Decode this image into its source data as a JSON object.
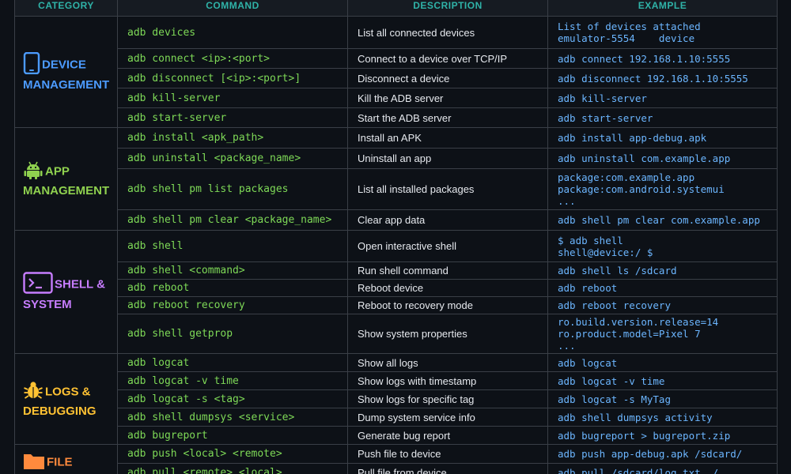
{
  "headers": {
    "category": "CATEGORY",
    "command": "COMMAND",
    "description": "DESCRIPTION",
    "example": "EXAMPLE"
  },
  "colors": {
    "device": "#4c9bff",
    "app": "#8fd14f",
    "shell": "#c77dff",
    "logs": "#ffc233",
    "file": "#ff8a3d",
    "command_text": "#7ed957",
    "example_text": "#6cb6ff",
    "header_text": "#2fb3a8"
  },
  "categories": [
    {
      "icon": "smartphone-icon",
      "line1": "DEVICE",
      "line2": "MANAGEMENT",
      "rows": [
        {
          "cmd": "adb devices",
          "desc": "List all connected devices",
          "ex": "List of devices attached\nemulator-5554    device"
        },
        {
          "cmd": "adb connect <ip>:<port>",
          "desc": "Connect to a device over TCP/IP",
          "ex": "adb connect 192.168.1.10:5555"
        },
        {
          "cmd": "adb disconnect [<ip>:<port>]",
          "desc": "Disconnect a device",
          "ex": "adb disconnect 192.168.1.10:5555"
        },
        {
          "cmd": "adb kill-server",
          "desc": "Kill the ADB server",
          "ex": "adb kill-server"
        },
        {
          "cmd": "adb start-server",
          "desc": "Start the ADB server",
          "ex": "adb start-server"
        }
      ]
    },
    {
      "icon": "android-icon",
      "line1": "APP",
      "line2": "MANAGEMENT",
      "rows": [
        {
          "cmd": "adb install <apk_path>",
          "desc": "Install an APK",
          "ex": "adb install app-debug.apk"
        },
        {
          "cmd": "adb uninstall <package_name>",
          "desc": "Uninstall an app",
          "ex": "adb uninstall com.example.app"
        },
        {
          "cmd": "adb shell pm list packages",
          "desc": "List all installed packages",
          "ex": "package:com.example.app\npackage:com.android.systemui\n..."
        },
        {
          "cmd": "adb shell pm clear <package_name>",
          "desc": "Clear app data",
          "ex": "adb shell pm clear com.example.app"
        }
      ]
    },
    {
      "icon": "terminal-icon",
      "line1": "SHELL &",
      "line2": "SYSTEM",
      "rows": [
        {
          "cmd": "adb shell",
          "desc": "Open interactive shell",
          "ex": "$ adb shell\nshell@device:/ $"
        },
        {
          "cmd": "adb shell <command>",
          "desc": "Run shell command",
          "ex": "adb shell ls /sdcard"
        },
        {
          "cmd": "adb reboot",
          "desc": "Reboot device",
          "ex": "adb reboot"
        },
        {
          "cmd": "adb reboot recovery",
          "desc": "Reboot to recovery mode",
          "ex": "adb reboot recovery"
        },
        {
          "cmd": "adb shell getprop",
          "desc": "Show system properties",
          "ex": "ro.build.version.release=14\nro.product.model=Pixel 7\n..."
        }
      ]
    },
    {
      "icon": "bug-icon",
      "line1": "LOGS &",
      "line2": "DEBUGGING",
      "rows": [
        {
          "cmd": "adb logcat",
          "desc": "Show all logs",
          "ex": "adb logcat"
        },
        {
          "cmd": "adb logcat -v time",
          "desc": "Show logs with timestamp",
          "ex": "adb logcat -v time"
        },
        {
          "cmd": "adb logcat -s <tag>",
          "desc": "Show logs for specific tag",
          "ex": "adb logcat -s MyTag"
        },
        {
          "cmd": "adb shell dumpsys <service>",
          "desc": "Dump system service info",
          "ex": "adb shell dumpsys activity"
        },
        {
          "cmd": "adb bugreport",
          "desc": "Generate bug report",
          "ex": "adb bugreport > bugreport.zip"
        }
      ]
    },
    {
      "icon": "folder-icon",
      "line1": "FILE",
      "line2": "",
      "rows": [
        {
          "cmd": "adb push <local> <remote>",
          "desc": "Push file to device",
          "ex": "adb push app-debug.apk /sdcard/"
        },
        {
          "cmd": "adb pull <remote> <local>",
          "desc": "Pull file from device",
          "ex": "adb pull /sdcard/log.txt ./"
        }
      ]
    }
  ]
}
